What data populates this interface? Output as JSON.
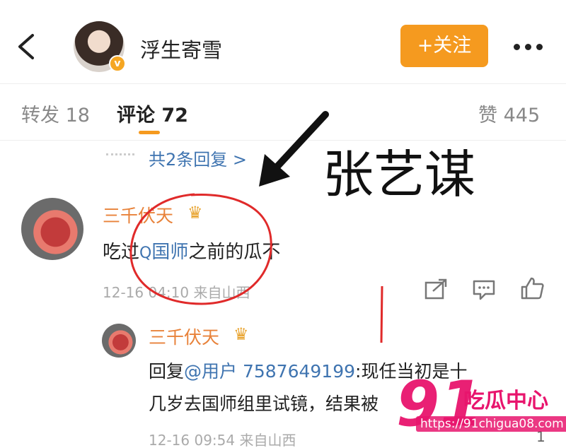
{
  "header": {
    "back_icon": "chevron-left-icon",
    "author_name": "浮生寄雪",
    "verified_badge": "v",
    "follow_label": "+关注",
    "more_icon": "more-dots-icon"
  },
  "tabs": [
    {
      "label": "转发 18"
    },
    {
      "label": "评论 72"
    },
    {
      "label": "赞 445"
    }
  ],
  "more_replies": "共2条回复 >",
  "overlay_name": "张艺谋",
  "comment": {
    "user": "三千伏天",
    "text_before": "吃过",
    "topic_glyph": "Q",
    "topic": "国师",
    "text_after": "之前的瓜不",
    "time": "12-16 04:10",
    "source": "来自山西"
  },
  "reply": {
    "user": "三千伏天",
    "prefix": "回复",
    "mention": "@用户 7587649199",
    "text_line1": ":现任当初是十",
    "text_line2": "几岁去国师组里试镜，结果被",
    "time": "12-16 09:54",
    "source": "来自山西",
    "like_count": "1"
  },
  "watermark": {
    "number": "91",
    "brand": "吃瓜中心",
    "url": "https://91chigua08.com"
  },
  "colors": {
    "accent": "#f59a1f",
    "link": "#3f74b0",
    "username": "#e8823a",
    "annotation_red": "#e02a2a",
    "watermark": "#e8156d"
  }
}
